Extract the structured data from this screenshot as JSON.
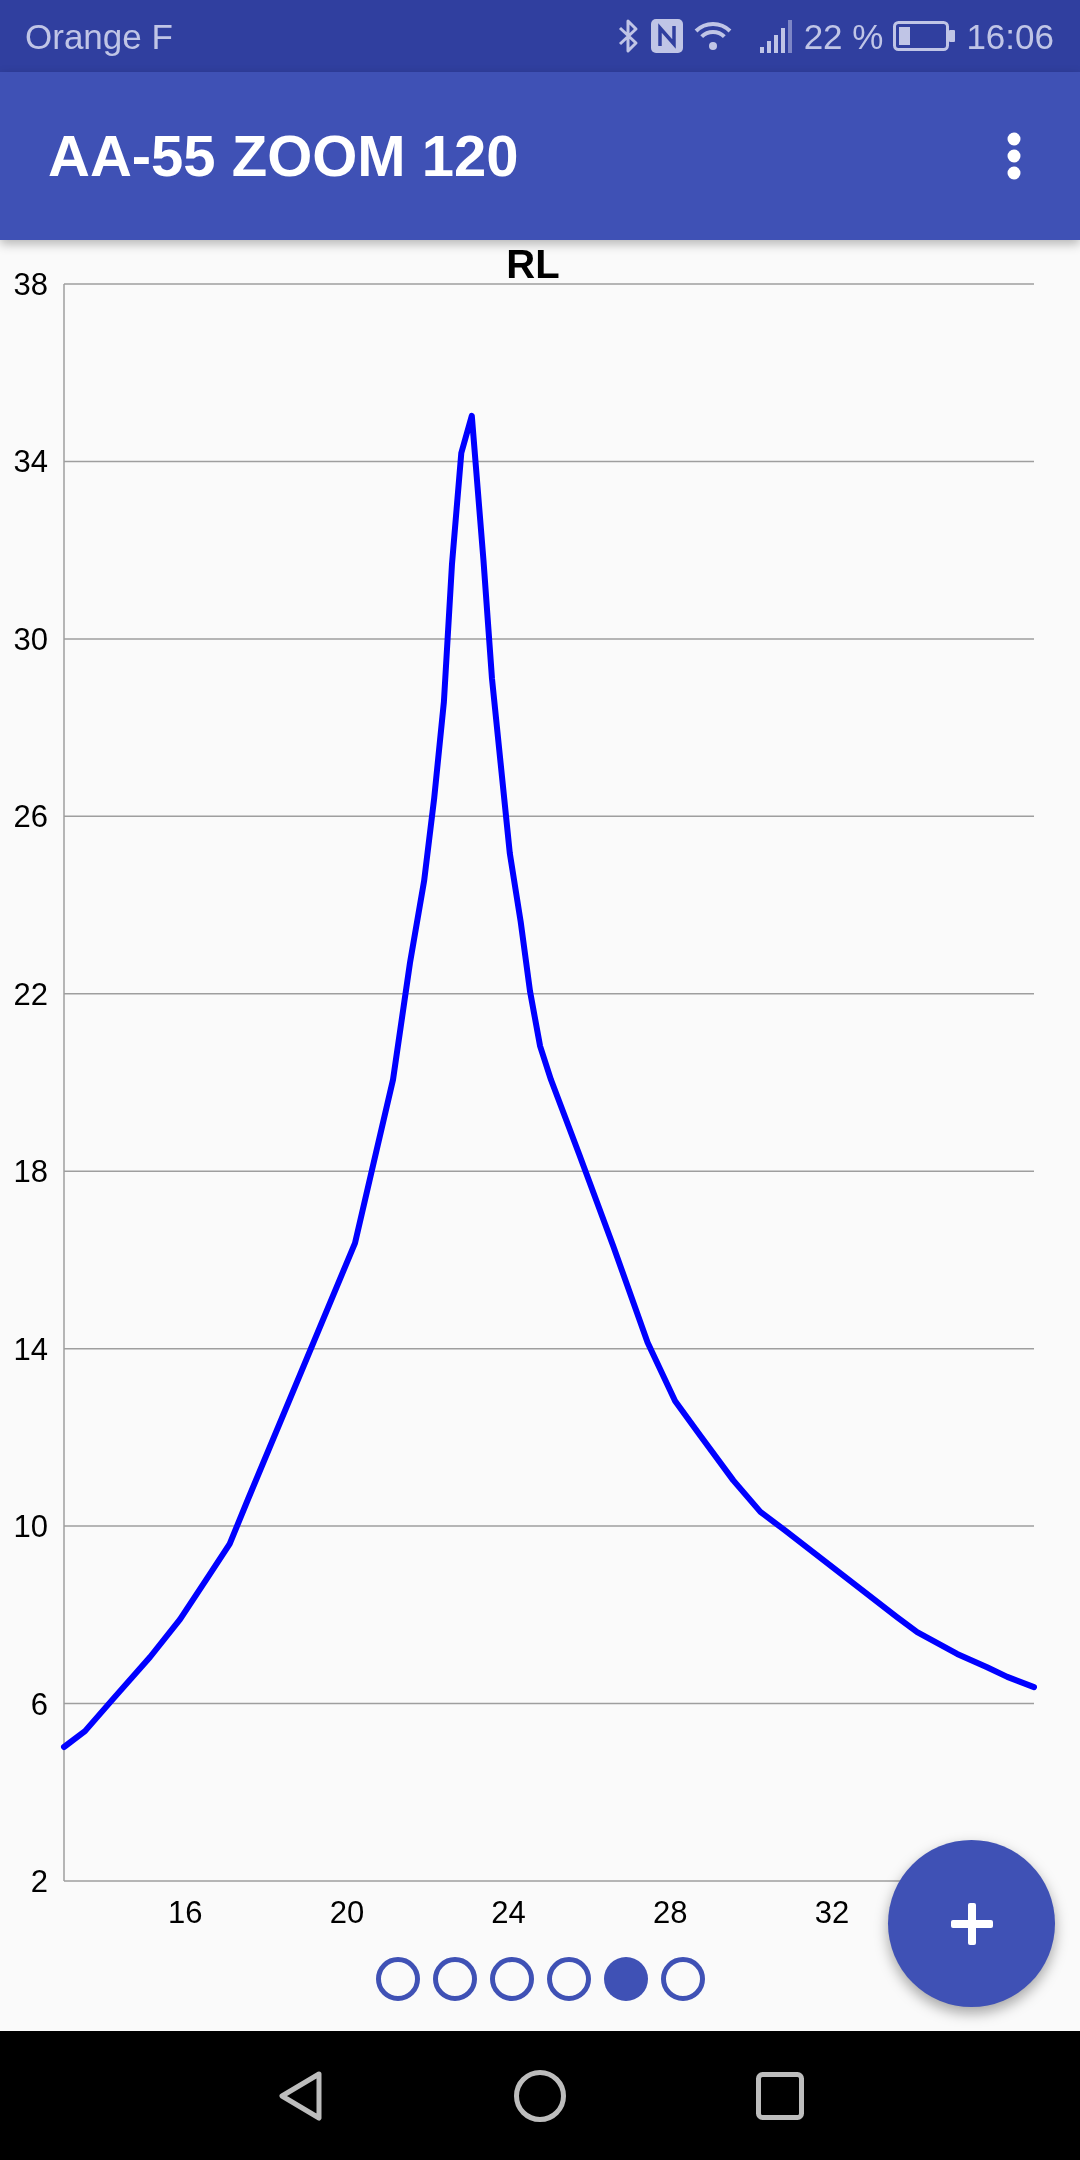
{
  "status_bar": {
    "carrier": "Orange F",
    "battery": "22 %",
    "time": "16:06"
  },
  "app_bar": {
    "title": "AA-55 ZOOM 120"
  },
  "chart": {
    "chart_data": {
      "type": "line",
      "title": "RL",
      "x": [
        13,
        13.52,
        14.21,
        15.13,
        15.87,
        16.56,
        17.1,
        17.55,
        20.2,
        20.62,
        21.14,
        21.56,
        21.91,
        22.16,
        22.4,
        22.6,
        22.83,
        23.09,
        23.38,
        23.59,
        24.03,
        24.3,
        24.53,
        24.78,
        25.05,
        25.74,
        26.59,
        27.44,
        28.12,
        28.74,
        29.56,
        30.23,
        30.8,
        33.61,
        34.11,
        35.1,
        35.84,
        36.34,
        37
      ],
      "series": [
        {
          "color": "#0000ff",
          "values": [
            5.02,
            5.38,
            6.1,
            7.05,
            7.9,
            8.85,
            9.6,
            10.6,
            16.38,
            18.03,
            20.06,
            22.7,
            24.54,
            26.41,
            28.58,
            31.69,
            34.19,
            35.03,
            31.76,
            29.1,
            25.17,
            23.62,
            22.06,
            20.82,
            20.06,
            18.4,
            16.31,
            14.14,
            12.82,
            12.04,
            11.03,
            10.32,
            9.93,
            7.95,
            7.61,
            7.12,
            6.82,
            6.6,
            6.37
          ]
        }
      ],
      "xlim": [
        13,
        37
      ],
      "ylim": [
        2,
        38
      ],
      "xticks": [
        16,
        20,
        24,
        28,
        32
      ],
      "yticks": [
        2,
        6,
        10,
        14,
        18,
        22,
        26,
        30,
        34,
        38
      ],
      "grid": true
    }
  },
  "pager": [
    {
      "selected": false
    },
    {
      "selected": false
    },
    {
      "selected": false
    },
    {
      "selected": false
    },
    {
      "selected": true
    },
    {
      "selected": false
    }
  ]
}
